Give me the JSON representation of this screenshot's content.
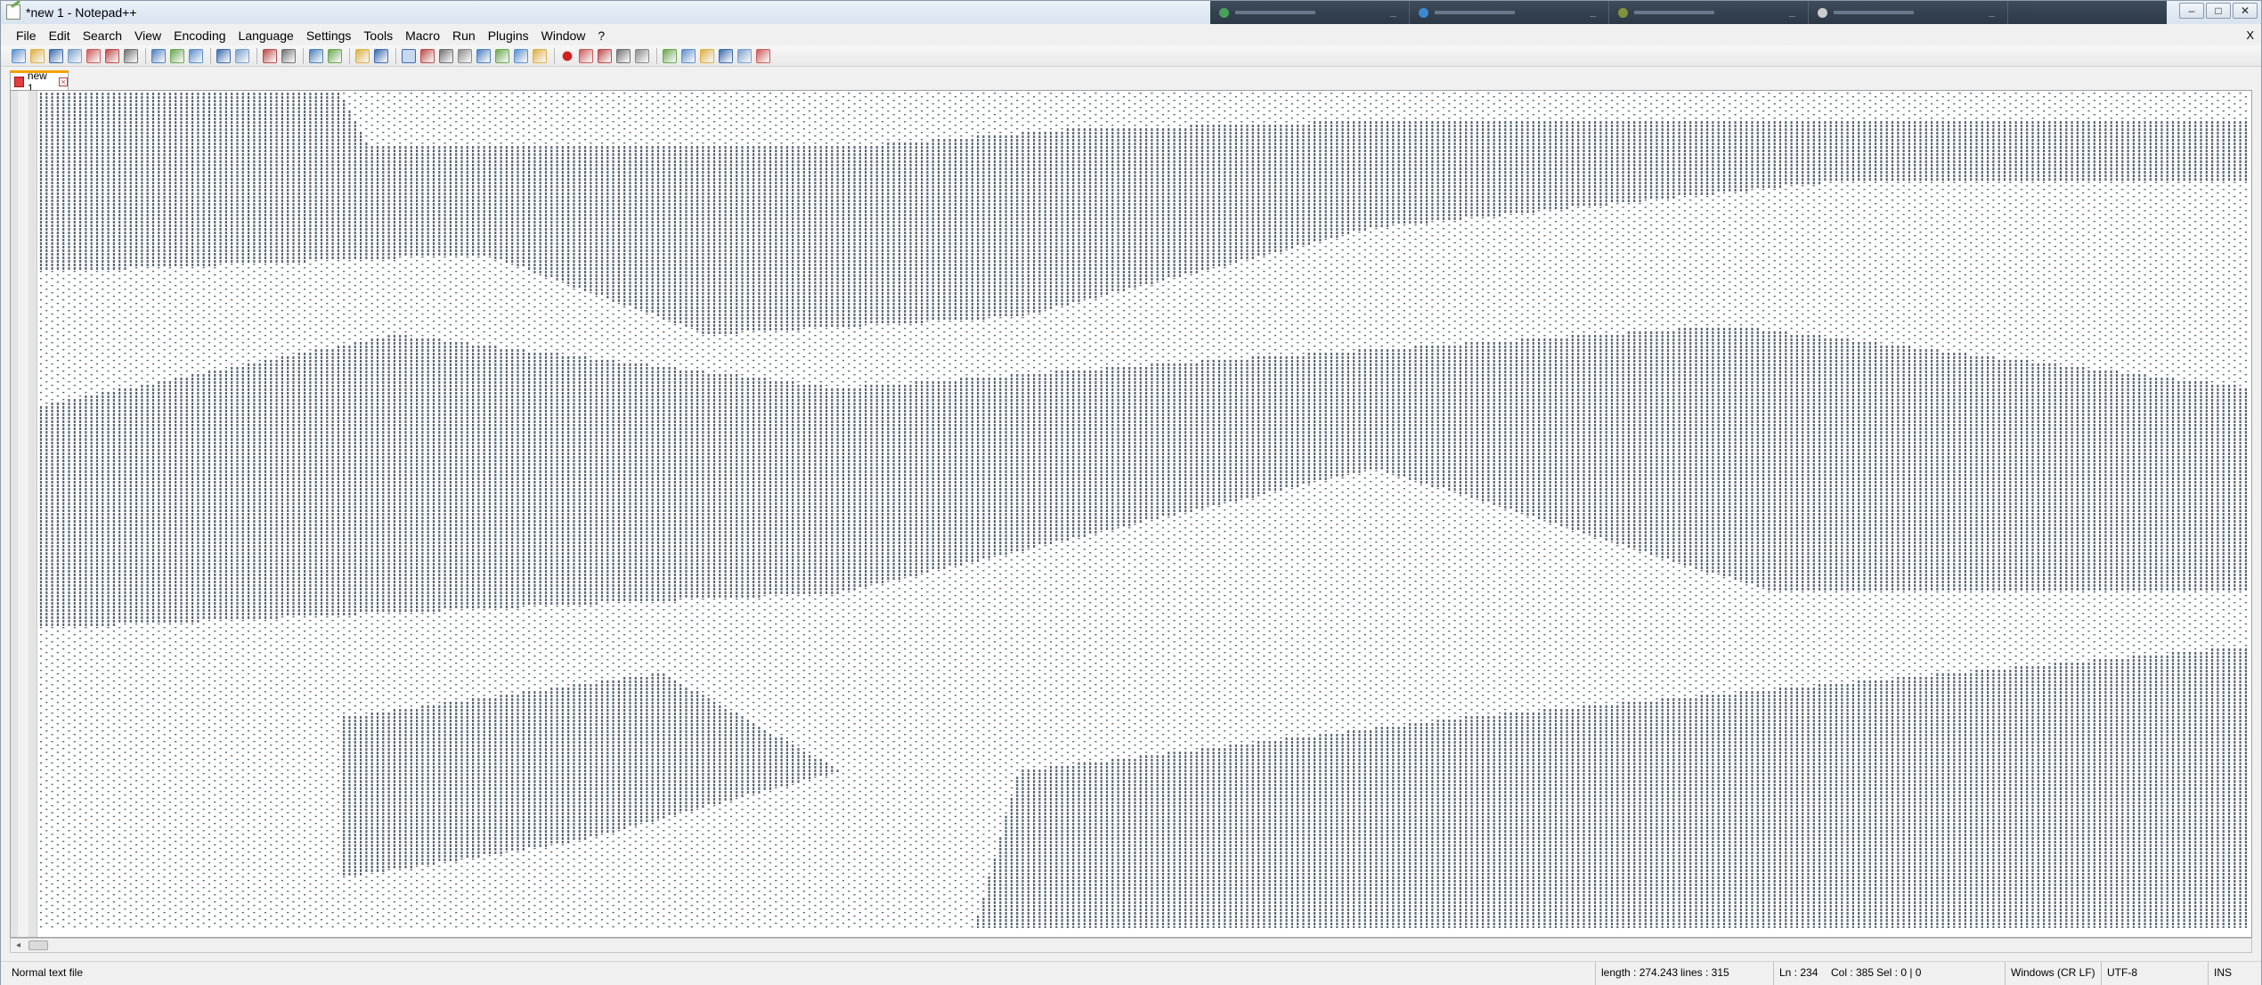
{
  "window": {
    "title": "*new 1 - Notepad++",
    "controls": [
      "‒",
      "□",
      "✕"
    ]
  },
  "taskbar": {
    "dots": [
      "#3a9a4a",
      "#2b7fd0",
      "#7a8a2a",
      "#c9c9c9"
    ]
  },
  "menu": {
    "items": [
      "File",
      "Edit",
      "Search",
      "View",
      "Encoding",
      "Language",
      "Settings",
      "Tools",
      "Macro",
      "Run",
      "Plugins",
      "Window",
      "?"
    ],
    "close": "X"
  },
  "toolbar": {
    "icons": [
      "new-file",
      "open-file",
      "save",
      "save-all",
      "close",
      "close-all",
      "print",
      "|",
      "cut",
      "copy",
      "paste",
      "|",
      "undo",
      "redo",
      "|",
      "find",
      "replace",
      "|",
      "zoom-in",
      "zoom-out",
      "|",
      "sync-vertical",
      "sync-horizontal",
      "|",
      "word-wrap",
      "show-all-chars",
      "indent-guide",
      "doc-map",
      "function-list",
      "folder-workspace",
      "monitoring",
      "user-defined-language",
      "|",
      "record-macro",
      "stop-recording",
      "playback",
      "run-macro-multiple",
      "save-macro",
      "|",
      "compare",
      "previous-diff",
      "next-diff",
      "compare-options",
      "spell-check",
      "plugin-admin"
    ]
  },
  "tabs": [
    {
      "label": "new 1",
      "modified": true
    }
  ],
  "editor": {
    "ink_color": "#2c3e52"
  },
  "status": {
    "file_type": "Normal text file",
    "length": "length : 274.243",
    "lines": "lines : 315",
    "ln": "Ln : 234",
    "col": "Col : 385",
    "sel": "Sel : 0 | 0",
    "eol": "Windows (CR LF)",
    "encoding": "UTF-8",
    "mode": "INS"
  }
}
